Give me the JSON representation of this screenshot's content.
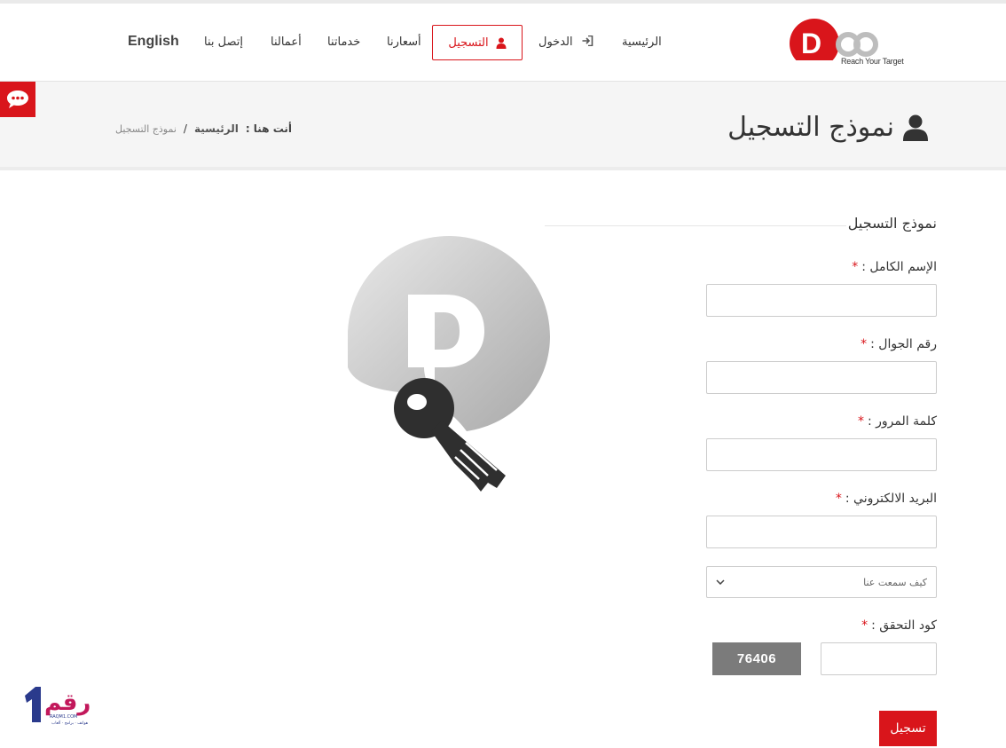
{
  "nav": {
    "english": "English",
    "contact": "إتصل بنا",
    "works": "أعمالنا",
    "services": "خدماتنا",
    "prices": "أسعارنا",
    "register": "التسجيل",
    "login": "الدخول",
    "home": "الرئيسية"
  },
  "logo": {
    "letters": "DOO",
    "tagline": "Reach Your Target"
  },
  "page": {
    "title": "نموذج التسجيل"
  },
  "breadcrumb": {
    "you_are_here": "أنت هنا :",
    "home": "الرئيسية",
    "separator": "/",
    "current": "نموذج التسجيل"
  },
  "form": {
    "title": "نموذج التسجيل",
    "required_mark": "*",
    "fields": [
      {
        "label": "الإسم الكامل :",
        "value": ""
      },
      {
        "label": "رقم الجوال :",
        "value": ""
      },
      {
        "label": "كلمة المرور :",
        "value": ""
      },
      {
        "label": "البريد الالكتروني :",
        "value": ""
      }
    ],
    "source_select": {
      "selected": "كيف سمعت عنا"
    },
    "captcha": {
      "label": "كود التحقق :",
      "code": "76406",
      "value": ""
    },
    "submit_label": "تسجيل"
  },
  "watermark": {
    "text": "رقم",
    "sub": "RAQM1.COM",
    "caption": "هواتف · برامج · ألعاب"
  },
  "colors": {
    "accent": "#d9151b",
    "band": "#f5f5f5",
    "captcha_bg": "#7b7b7b"
  }
}
